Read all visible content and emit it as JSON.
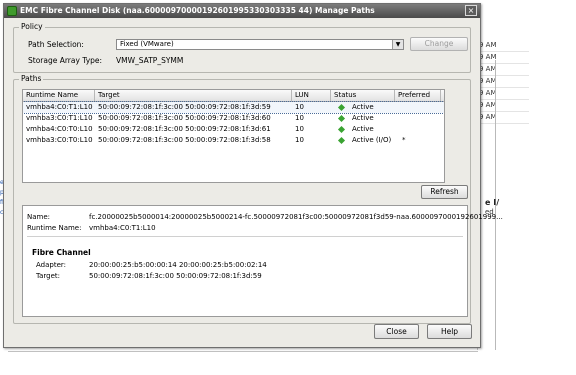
{
  "background": {
    "times": [
      "9 AM",
      "9 AM",
      "9 AM",
      "9 AM",
      "9 AM",
      "9 AM",
      "9 AM"
    ],
    "right_title": "e I/",
    "right_sub": "ed",
    "left_links": [
      "es",
      "py",
      "file",
      "ca"
    ]
  },
  "dialog": {
    "title": "EMC Fibre Channel Disk (naa.60000970000192601995330303335 44) Manage Paths",
    "close_glyph": "×",
    "policy": {
      "group_label": "Policy",
      "path_selection_label": "Path Selection:",
      "path_selection_value": "Fixed (VMware)",
      "change_label": "Change",
      "storage_array_type_label": "Storage Array Type:",
      "storage_array_type_value": "VMW_SATP_SYMM"
    },
    "paths": {
      "group_label": "Paths",
      "columns": [
        "Runtime Name",
        "Target",
        "LUN",
        "Status",
        "Preferred"
      ],
      "rows": [
        {
          "runtime": "vmhba4:C0:T1:L10",
          "target": "50:00:09:72:08:1f:3c:00 50:00:09:72:08:1f:3d:59",
          "lun": "10",
          "status": "Active",
          "preferred": ""
        },
        {
          "runtime": "vmhba3:C0:T1:L10",
          "target": "50:00:09:72:08:1f:3c:00 50:00:09:72:08:1f:3d:60",
          "lun": "10",
          "status": "Active",
          "preferred": ""
        },
        {
          "runtime": "vmhba4:C0:T0:L10",
          "target": "50:00:09:72:08:1f:3c:00 50:00:09:72:08:1f:3d:61",
          "lun": "10",
          "status": "Active",
          "preferred": ""
        },
        {
          "runtime": "vmhba3:C0:T0:L10",
          "target": "50:00:09:72:08:1f:3c:00 50:00:09:72:08:1f:3d:58",
          "lun": "10",
          "status": "Active (I/O)",
          "preferred": "*"
        }
      ],
      "refresh_label": "Refresh"
    },
    "details": {
      "name_label": "Name:",
      "name_value": "fc.20000025b5000014:20000025b5000214-fc.50000972081f3c00:50000972081f3d59-naa.6000097000192601999...",
      "runtime_label": "Runtime Name:",
      "runtime_value": "vmhba4:C0:T1:L10",
      "section_title": "Fibre Channel",
      "adapter_label": "Adapter:",
      "adapter_value": "20:00:00:25:b5:00:00:14 20:00:00:25:b5:00:02:14",
      "target_label": "Target:",
      "target_value": "50:00:09:72:08:1f:3c:00 50:00:09:72:08:1f:3d:59"
    },
    "footer": {
      "close_label": "Close",
      "help_label": "Help"
    }
  },
  "colors": {
    "active_status": "#3aa332",
    "titlebar": "#4a4a4a",
    "dialog_bg": "#ecebe6"
  }
}
